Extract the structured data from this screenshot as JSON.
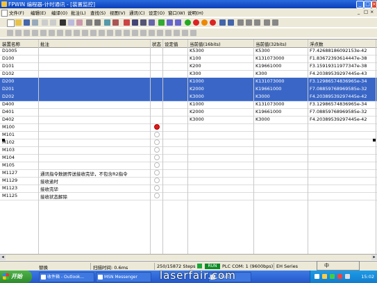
{
  "window": {
    "title": "FPWIN 编程器-计时通讯 - [装置监控]",
    "controls": [
      "_",
      "□",
      "×"
    ]
  },
  "menu": {
    "items": [
      "文件(F)",
      "编辑(E)",
      "编译(O)",
      "批注(L)",
      "查找(S)",
      "视图(V)",
      "通讯(C)",
      "设定(O)",
      "窗口(W)",
      "说明(H)"
    ],
    "mdi_controls": [
      "_",
      "□",
      "×"
    ]
  },
  "table": {
    "headers": [
      "装置名称",
      "批注",
      "状态",
      "设定值",
      "当前值(16bits)",
      "当前值(32bits)",
      "浮点数"
    ],
    "rows": [
      {
        "name": "D1005",
        "comment": "",
        "status": "",
        "setval": "",
        "v16": "K5300",
        "v32": "K5300",
        "float": "F7.42688186092153e-42",
        "selected": false
      },
      {
        "name": "D100",
        "comment": "",
        "status": "",
        "setval": "",
        "v16": "K100",
        "v32": "K131073000",
        "float": "F1.83672393614447e-38",
        "selected": false
      },
      {
        "name": "D101",
        "comment": "",
        "status": "",
        "setval": "",
        "v16": "K200",
        "v32": "K19661000",
        "float": "F3.15919311977347e-38",
        "selected": false
      },
      {
        "name": "D102",
        "comment": "",
        "status": "",
        "setval": "",
        "v16": "K300",
        "v32": "K300",
        "float": "F4.20389539297445e-43",
        "selected": false
      },
      {
        "name": "D200",
        "comment": "",
        "status": "",
        "setval": "",
        "v16": "K1000",
        "v32": "K131073000",
        "float": "F3.12986574836965e-34",
        "selected": true
      },
      {
        "name": "D201",
        "comment": "",
        "status": "",
        "setval": "",
        "v16": "K2000",
        "v32": "K19661000",
        "float": "F7.08859768969585e-32",
        "selected": true
      },
      {
        "name": "D202",
        "comment": "",
        "status": "",
        "setval": "",
        "v16": "K3000",
        "v32": "K3000",
        "float": "F4.20389539297445e-42",
        "selected": true
      },
      {
        "name": "D400",
        "comment": "",
        "status": "",
        "setval": "",
        "v16": "K1000",
        "v32": "K131073000",
        "float": "F3.12986574836965e-34",
        "selected": false
      },
      {
        "name": "D401",
        "comment": "",
        "status": "",
        "setval": "",
        "v16": "K2000",
        "v32": "K19661000",
        "float": "F7.08859768969585e-32",
        "selected": false
      },
      {
        "name": "D402",
        "comment": "",
        "status": "",
        "setval": "",
        "v16": "K3000",
        "v32": "K3000",
        "float": "F4.20389539297445e-42",
        "selected": false
      },
      {
        "name": "M100",
        "comment": "",
        "status": "on",
        "setval": "",
        "v16": "",
        "v32": "",
        "float": "",
        "selected": false
      },
      {
        "name": "M101",
        "comment": "",
        "status": "off",
        "setval": "",
        "v16": "",
        "v32": "",
        "float": "",
        "selected": false
      },
      {
        "name": "M102",
        "comment": "",
        "status": "off",
        "setval": "",
        "v16": "",
        "v32": "",
        "float": "",
        "selected": false
      },
      {
        "name": "M103",
        "comment": "",
        "status": "off",
        "setval": "",
        "v16": "",
        "v32": "",
        "float": "",
        "selected": false
      },
      {
        "name": "M104",
        "comment": "",
        "status": "off",
        "setval": "",
        "v16": "",
        "v32": "",
        "float": "",
        "selected": false
      },
      {
        "name": "M105",
        "comment": "",
        "status": "off",
        "setval": "",
        "v16": "",
        "v32": "",
        "float": "",
        "selected": false
      },
      {
        "name": "M1127",
        "comment": "通讯指令数据传送接收完毕，不包含R2指令",
        "status": "off",
        "setval": "",
        "v16": "",
        "v32": "",
        "float": "",
        "selected": false
      },
      {
        "name": "M1129",
        "comment": "接收逾时",
        "status": "off",
        "setval": "",
        "v16": "",
        "v32": "",
        "float": "",
        "selected": false
      },
      {
        "name": "M1123",
        "comment": "接收完毕",
        "status": "off",
        "setval": "",
        "v16": "",
        "v32": "",
        "float": "",
        "selected": false
      },
      {
        "name": "M1125",
        "comment": "接收状态解除",
        "status": "off",
        "setval": "",
        "v16": "",
        "v32": "",
        "float": "",
        "selected": false
      }
    ]
  },
  "status": {
    "mode": "替换",
    "scan_time": "扫描时间: 0.6ms",
    "steps": "250/15872 Steps",
    "run": "RUN",
    "plc": "PLC COM: 1",
    "baud": "(9600bps)",
    "series": "EH Series"
  },
  "taskbar": {
    "start_label": "开始",
    "tasks": [
      "收件箱 - Outlook...",
      "MSN Messenger",
      "...Soft"
    ],
    "clock": "15:02"
  },
  "watermark": "laserfair.com",
  "ime": {
    "lang": "中"
  }
}
